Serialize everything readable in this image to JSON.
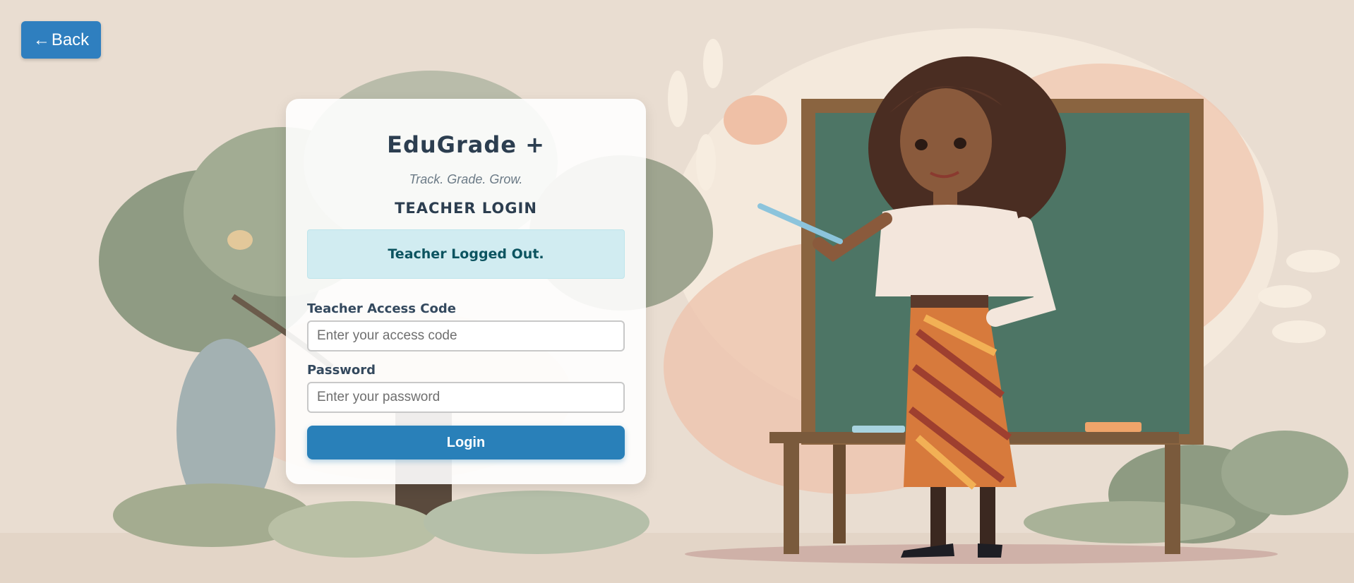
{
  "nav": {
    "back_arrow": "←",
    "back_label": "Back"
  },
  "login_card": {
    "app_name": "EduGrade +",
    "tagline": "Track. Grade. Grow.",
    "heading": "TEACHER LOGIN",
    "alert_message": "Teacher Logged Out.",
    "access_code": {
      "label": "Teacher Access Code",
      "placeholder": "Enter your access code",
      "value": ""
    },
    "password": {
      "label": "Password",
      "placeholder": "Enter your password",
      "value": ""
    },
    "submit_label": "Login"
  },
  "colors": {
    "primary": "#2980b9",
    "alert_bg": "#d1ecf1",
    "alert_text": "#0c5460",
    "heading": "#2c3e50",
    "background": "#e9ddd1"
  },
  "icons": {
    "back": "left-arrow-icon"
  }
}
